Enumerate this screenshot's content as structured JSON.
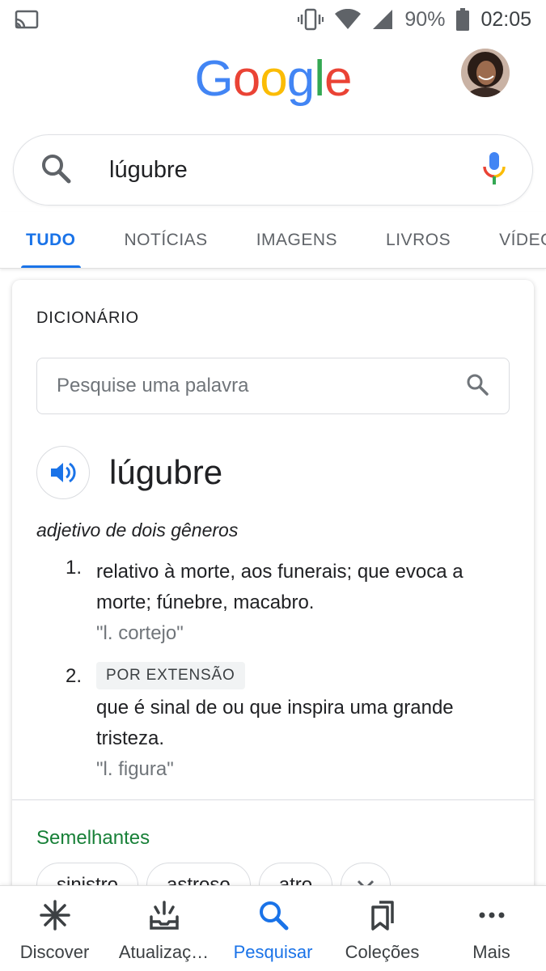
{
  "status_bar": {
    "battery": "90%",
    "time": "02:05",
    "icons": [
      "cast-icon",
      "vibrate-icon",
      "wifi-icon",
      "signal-icon",
      "battery-icon"
    ]
  },
  "header": {
    "logo_letters": [
      "G",
      "o",
      "o",
      "g",
      "l",
      "e"
    ],
    "logo_colors": [
      "#4285F4",
      "#EA4335",
      "#FBBC05",
      "#4285F4",
      "#34A853",
      "#EA4335"
    ]
  },
  "search": {
    "query": "lúgubre"
  },
  "tabs": [
    {
      "label": "TUDO",
      "active": true
    },
    {
      "label": "NOTÍCIAS",
      "active": false
    },
    {
      "label": "IMAGENS",
      "active": false
    },
    {
      "label": "LIVROS",
      "active": false
    },
    {
      "label": "VÍDEOS",
      "active": false
    }
  ],
  "dictionary": {
    "title": "DICIONÁRIO",
    "search_placeholder": "Pesquise uma palavra",
    "headword": "lúgubre",
    "part_of_speech": "adjetivo de dois gêneros",
    "senses": [
      {
        "number": "1.",
        "definition": "relativo à morte, aos funerais; que evoca a morte; fúnebre, macabro.",
        "example": "\"l. cortejo\""
      },
      {
        "number": "2.",
        "tag": "POR EXTENSÃO",
        "definition": "que é sinal de ou que inspira uma grande tristeza.",
        "example": "\"l. figura\""
      }
    ],
    "similar_label": "Semelhantes",
    "similar_words": [
      "sinistro",
      "astroso",
      "atro"
    ]
  },
  "bottom_nav": [
    {
      "label": "Discover",
      "icon": "asterisk-icon",
      "active": false
    },
    {
      "label": "Atualizaç…",
      "icon": "updates-icon",
      "active": false
    },
    {
      "label": "Pesquisar",
      "icon": "search-icon",
      "active": true
    },
    {
      "label": "Coleções",
      "icon": "collections-icon",
      "active": false
    },
    {
      "label": "Mais",
      "icon": "more-dots-icon",
      "active": false
    }
  ],
  "colors": {
    "accent": "#1a73e8",
    "similar_green": "#188038"
  }
}
